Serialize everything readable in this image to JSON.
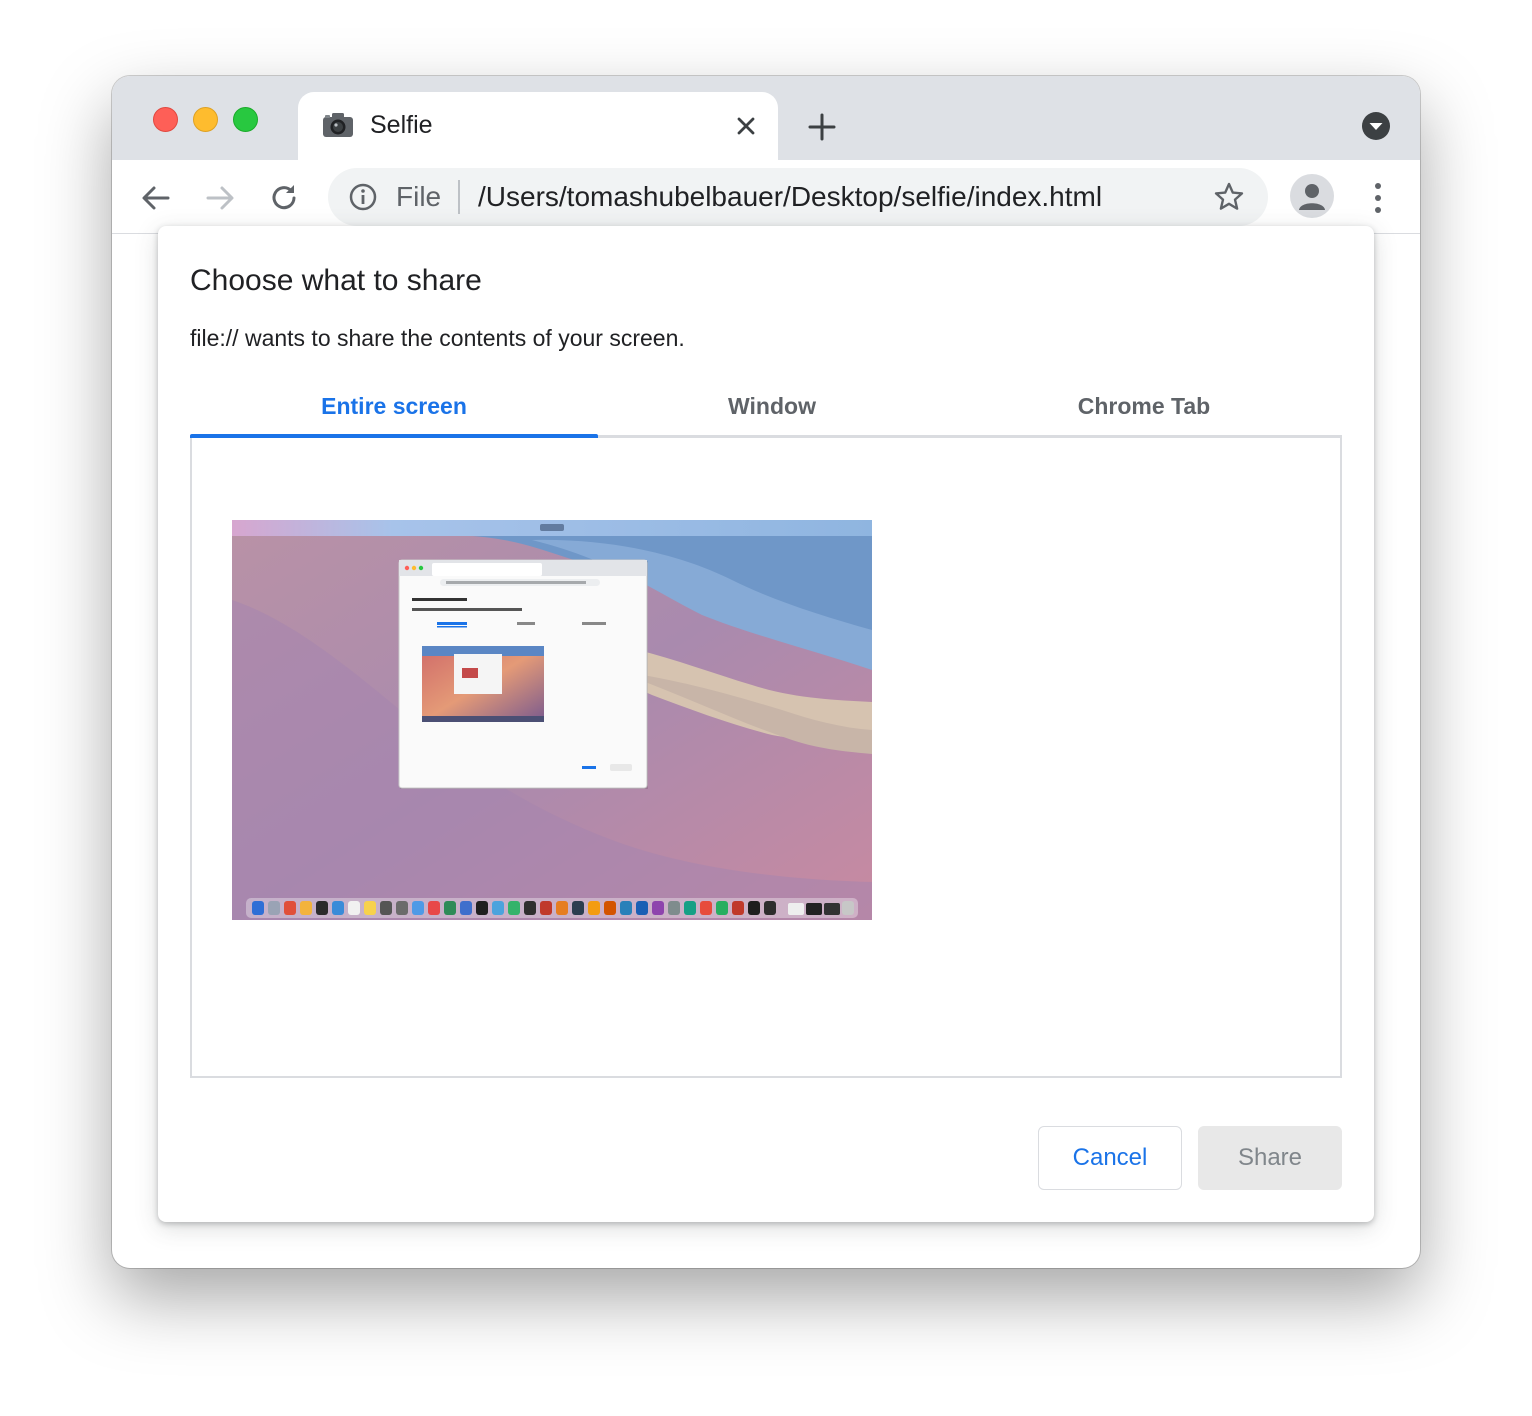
{
  "browser": {
    "tab": {
      "title": "Selfie",
      "favicon": "camera-icon"
    },
    "omnibox": {
      "scheme_label": "File",
      "url": "/Users/tomashubelbauer/Desktop/selfie/index.html"
    }
  },
  "dialog": {
    "title": "Choose what to share",
    "subtitle": "file:// wants to share the contents of your screen.",
    "tabs": [
      {
        "label": "Entire screen",
        "active": true
      },
      {
        "label": "Window",
        "active": false
      },
      {
        "label": "Chrome Tab",
        "active": false
      }
    ],
    "cancel_label": "Cancel",
    "share_label": "Share"
  },
  "colors": {
    "accent": "#1a73e8",
    "tabstrip": "#dee1e6",
    "traffic_red": "#fe5f57",
    "traffic_yellow": "#febc2e",
    "traffic_green": "#28c840"
  }
}
